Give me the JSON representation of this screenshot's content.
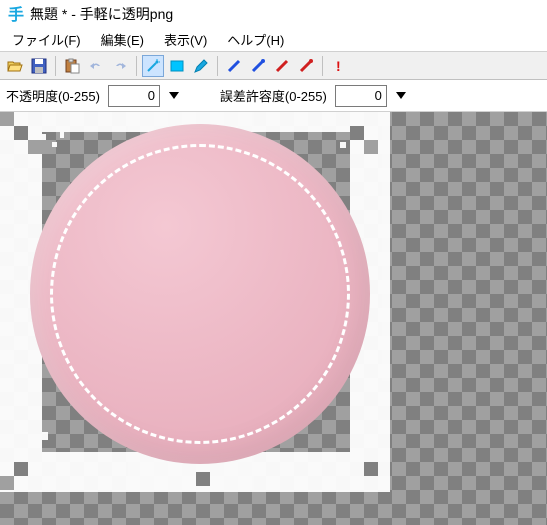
{
  "title": "無題 * - 手軽に透明png",
  "menus": {
    "file": "ファイル(F)",
    "edit": "編集(E)",
    "view": "表示(V)",
    "help": "ヘルプ(H)"
  },
  "params": {
    "opacity_label": "不透明度(0-255)",
    "opacity_value": "0",
    "tolerance_label": "誤差許容度(0-255)",
    "tolerance_value": "0"
  },
  "colors": {
    "accent": "#19a7e0",
    "fill": "#00c4ff",
    "warn": "#d11"
  }
}
